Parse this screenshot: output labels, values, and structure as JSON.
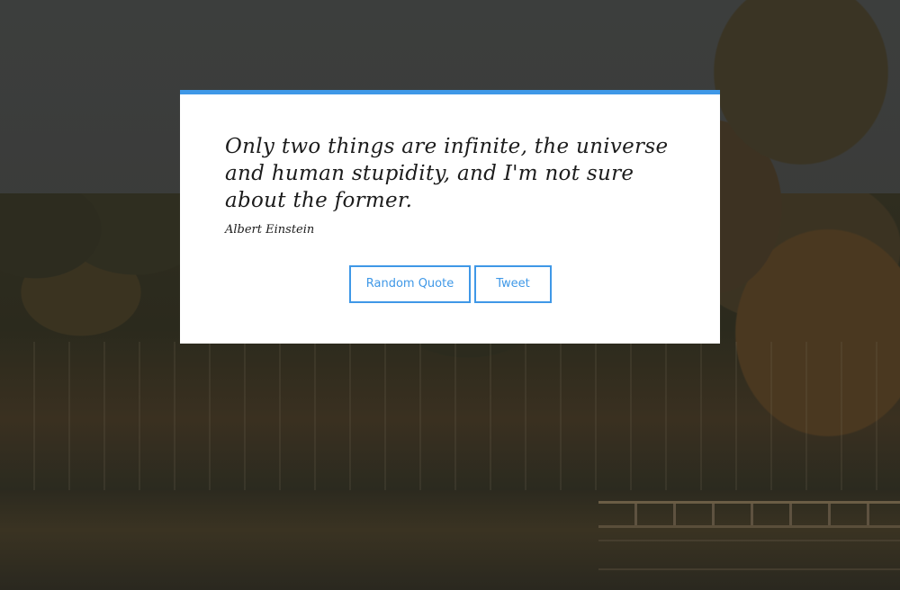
{
  "quote": {
    "text": "Only two things are infinite, the universe and human stupidity, and I'm not sure about the former.",
    "author": "Albert Einstein"
  },
  "buttons": {
    "random_label": "Random Quote",
    "tweet_label": "Tweet"
  },
  "colors": {
    "accent": "#3f98e7",
    "card_background": "#ffffff",
    "text": "#1c1c1c"
  }
}
